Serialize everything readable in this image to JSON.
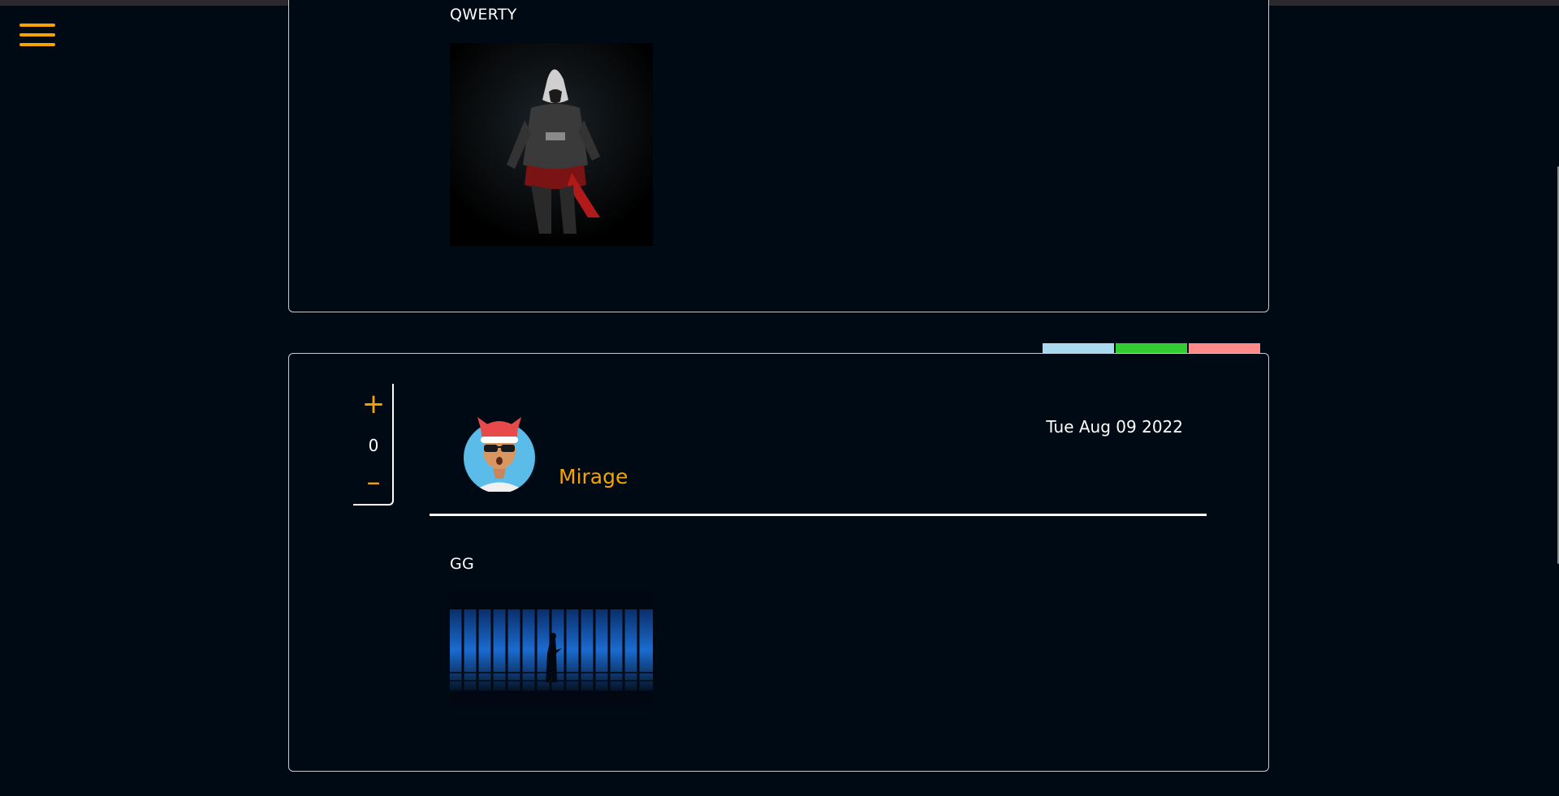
{
  "nav": {
    "menu_icon": "hamburger-menu-icon"
  },
  "posts": [
    {
      "text": "QWERTY",
      "image_desc": "hooded-assassin-image"
    },
    {
      "votes": {
        "up_label": "+",
        "count": "0",
        "down_label": "–"
      },
      "author": "Mirage",
      "date": "Tue Aug 09 2022",
      "text": "GG",
      "image_desc": "blue-panels-silhouette-image"
    }
  ],
  "tabs": [
    {
      "color": "#a9d8ef"
    },
    {
      "color": "#33cc33"
    },
    {
      "color": "#ff8a8a"
    }
  ]
}
